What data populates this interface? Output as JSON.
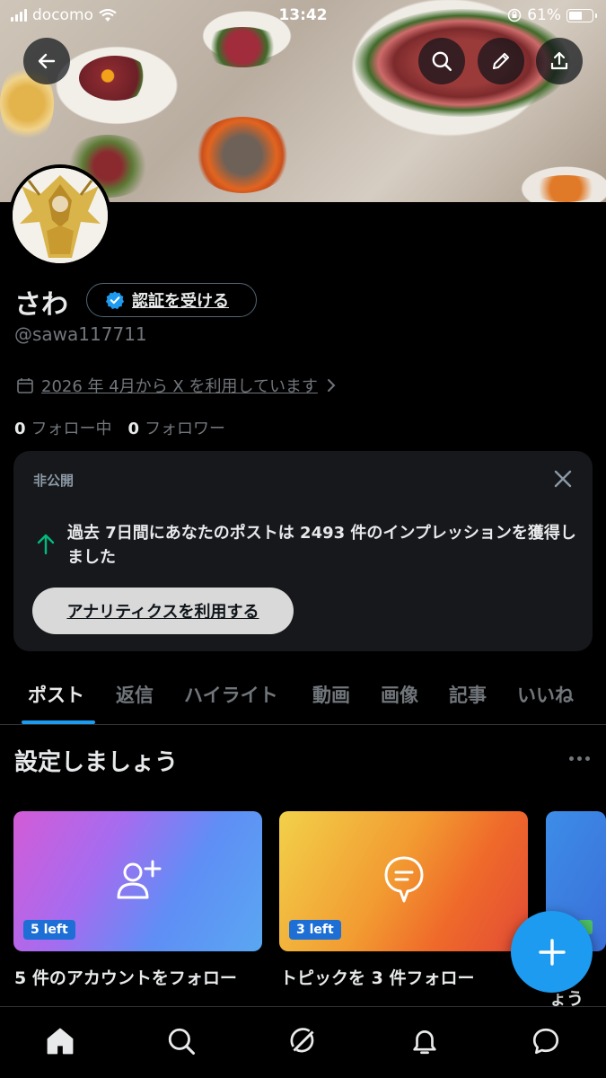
{
  "status_bar": {
    "carrier": "docomo",
    "time": "13:42",
    "battery_percent": "61%",
    "battery_level": 0.61
  },
  "header": {
    "back_icon": "arrow-left-icon",
    "search_icon": "search-icon",
    "edit_icon": "pencil-icon",
    "share_icon": "share-icon"
  },
  "profile": {
    "name": "さわ",
    "verify_label": "認証を受ける",
    "handle": "@sawa117711",
    "joined": "2026 年 4月から X を利用しています",
    "following_count": "0",
    "following_label": "フォロー中",
    "followers_count": "0",
    "followers_label": "フォロワー"
  },
  "analytics_card": {
    "private_label": "非公開",
    "message": "過去 7日間にあなたのポストは 2493 件のインプレッションを獲得しました",
    "cta_label": "アナリティクスを利用する"
  },
  "tabs": [
    {
      "label": "ポスト",
      "active": true
    },
    {
      "label": "返信",
      "active": false
    },
    {
      "label": "ハイライト",
      "active": false
    },
    {
      "label": "動画",
      "active": false
    },
    {
      "label": "画像",
      "active": false
    },
    {
      "label": "記事",
      "active": false
    },
    {
      "label": "いいね",
      "active": false
    }
  ],
  "setup": {
    "title": "設定しましょう",
    "cards": [
      {
        "badge": "5 left",
        "label": "5 件のアカウントをフォロー",
        "icon": "add-user-icon"
      },
      {
        "badge": "3 left",
        "label": "トピックを 3 件フォロー",
        "icon": "topic-bubble-icon"
      },
      {
        "badge": "",
        "label": "フィ ょう",
        "icon": ""
      }
    ]
  },
  "fab": {
    "icon": "plus-icon"
  },
  "bottom_nav": [
    {
      "name": "home",
      "icon": "home-icon"
    },
    {
      "name": "search",
      "icon": "search-icon"
    },
    {
      "name": "grok",
      "icon": "grok-icon"
    },
    {
      "name": "notifications",
      "icon": "bell-icon"
    },
    {
      "name": "messages",
      "icon": "message-icon"
    }
  ],
  "colors": {
    "accent": "#1d9bf0",
    "background": "#000000",
    "card": "#16181c",
    "muted_text": "#71767b",
    "up_arrow": "#00ba7c"
  }
}
